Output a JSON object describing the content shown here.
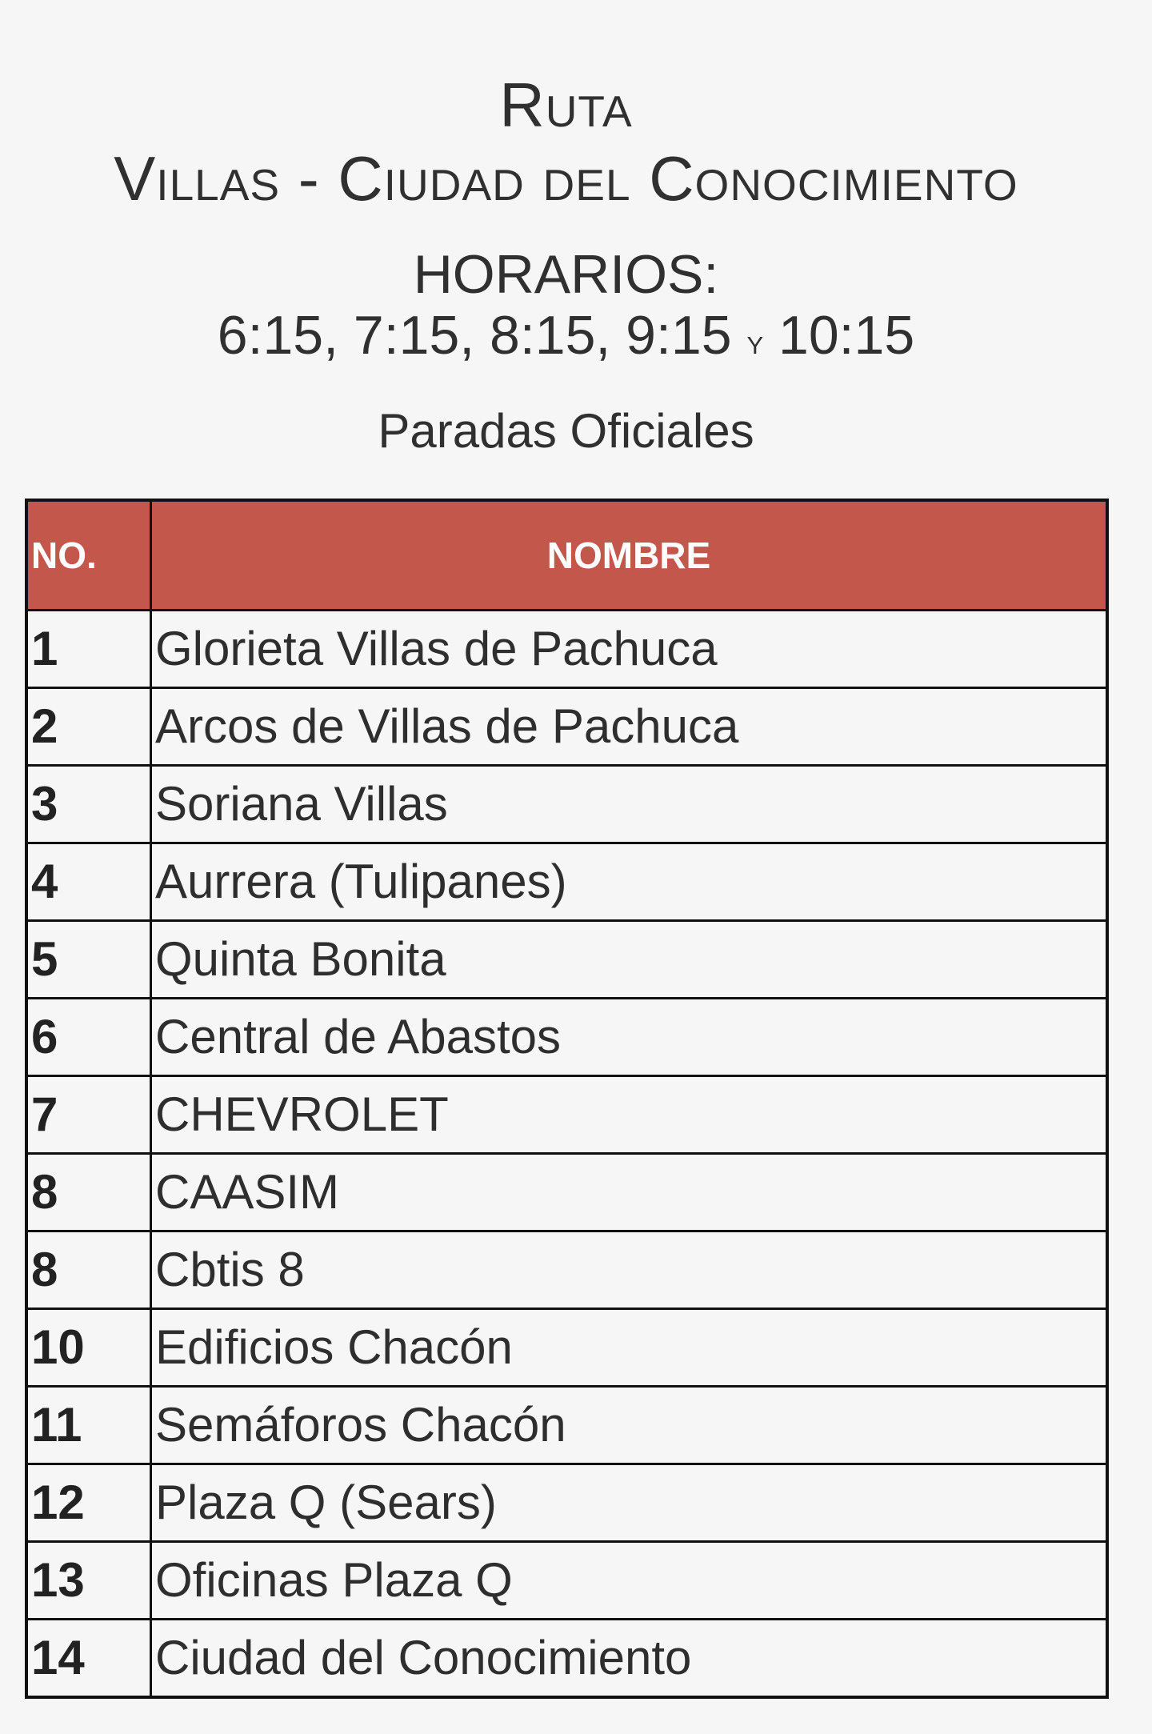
{
  "header": {
    "route_label": "Ruta",
    "route_name": "Villas - Ciudad del Conocimiento",
    "schedule_title": "HORARIOS:",
    "schedule_times": "6:15, 7:15, 8:15, 9:15",
    "schedule_conjunction": "y",
    "schedule_last_time": "10:15",
    "stops_title": "Paradas Oficiales"
  },
  "table": {
    "header_color": "#c4574b",
    "columns": [
      "NO.",
      "NOMBRE"
    ],
    "rows": [
      {
        "no": "1",
        "name": "Glorieta Villas de Pachuca"
      },
      {
        "no": "2",
        "name": "Arcos de Villas de Pachuca"
      },
      {
        "no": "3",
        "name": "Soriana Villas"
      },
      {
        "no": "4",
        "name": "Aurrera (Tulipanes)"
      },
      {
        "no": "5",
        "name": "Quinta Bonita"
      },
      {
        "no": "6",
        "name": "Central de Abastos"
      },
      {
        "no": "7",
        "name": "CHEVROLET"
      },
      {
        "no": "8",
        "name": "CAASIM"
      },
      {
        "no": "8",
        "name": "Cbtis 8"
      },
      {
        "no": "10",
        "name": "Edificios Chacón"
      },
      {
        "no": "11",
        "name": "Semáforos Chacón"
      },
      {
        "no": "12",
        "name": "Plaza Q (Sears)"
      },
      {
        "no": "13",
        "name": "Oficinas Plaza Q"
      },
      {
        "no": "14",
        "name": "Ciudad del Conocimiento"
      }
    ]
  }
}
